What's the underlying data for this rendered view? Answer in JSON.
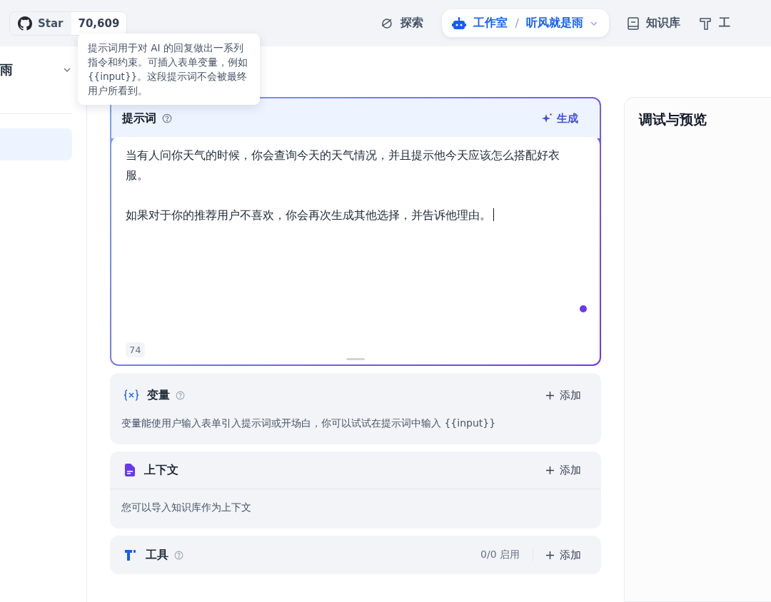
{
  "github": {
    "label": "Star",
    "count": "70,609"
  },
  "nav": [
    {
      "label": "探索",
      "kind": "explore",
      "selected": false
    },
    {
      "label": "工作室",
      "kind": "studio",
      "selected": true,
      "separator": "/",
      "breadcrumb": "听风就是雨"
    },
    {
      "label": "知识库",
      "kind": "knowledge",
      "selected": false
    },
    {
      "label": "工",
      "kind": "tools",
      "selected": false
    }
  ],
  "tooltip": "提示词用于对 AI 的回复做出一系列指令和约束。可插入表单变量，例如 {{input}}。这段提示词不会被最终用户所看到。",
  "sidebar": {
    "app_name": "雨",
    "items": [
      {
        "selected": true
      }
    ]
  },
  "prompt": {
    "title": "提示词",
    "generate": "生成",
    "paragraphs": [
      "当有人问你天气的时候，你会查询今天的天气情况，并且提示他今天应该怎么搭配好衣服。",
      "如果对于你的推荐用户不喜欢，你会再次生成其他选择，并告诉他理由。"
    ],
    "count": "74"
  },
  "sections": [
    {
      "kind": "variables",
      "title": "变量",
      "help": true,
      "add": "添加",
      "description": "变量能使用户输入表单引入提示词或开场白，你可以试试在提示词中输入 {{input}}"
    },
    {
      "kind": "context",
      "title": "上下文",
      "help": false,
      "add": "添加",
      "description": "您可以导入知识库作为上下文"
    },
    {
      "kind": "tools",
      "title": "工具",
      "help": true,
      "add": "添加",
      "status": "0/0 启用"
    }
  ],
  "preview": {
    "title": "调试与预览"
  }
}
